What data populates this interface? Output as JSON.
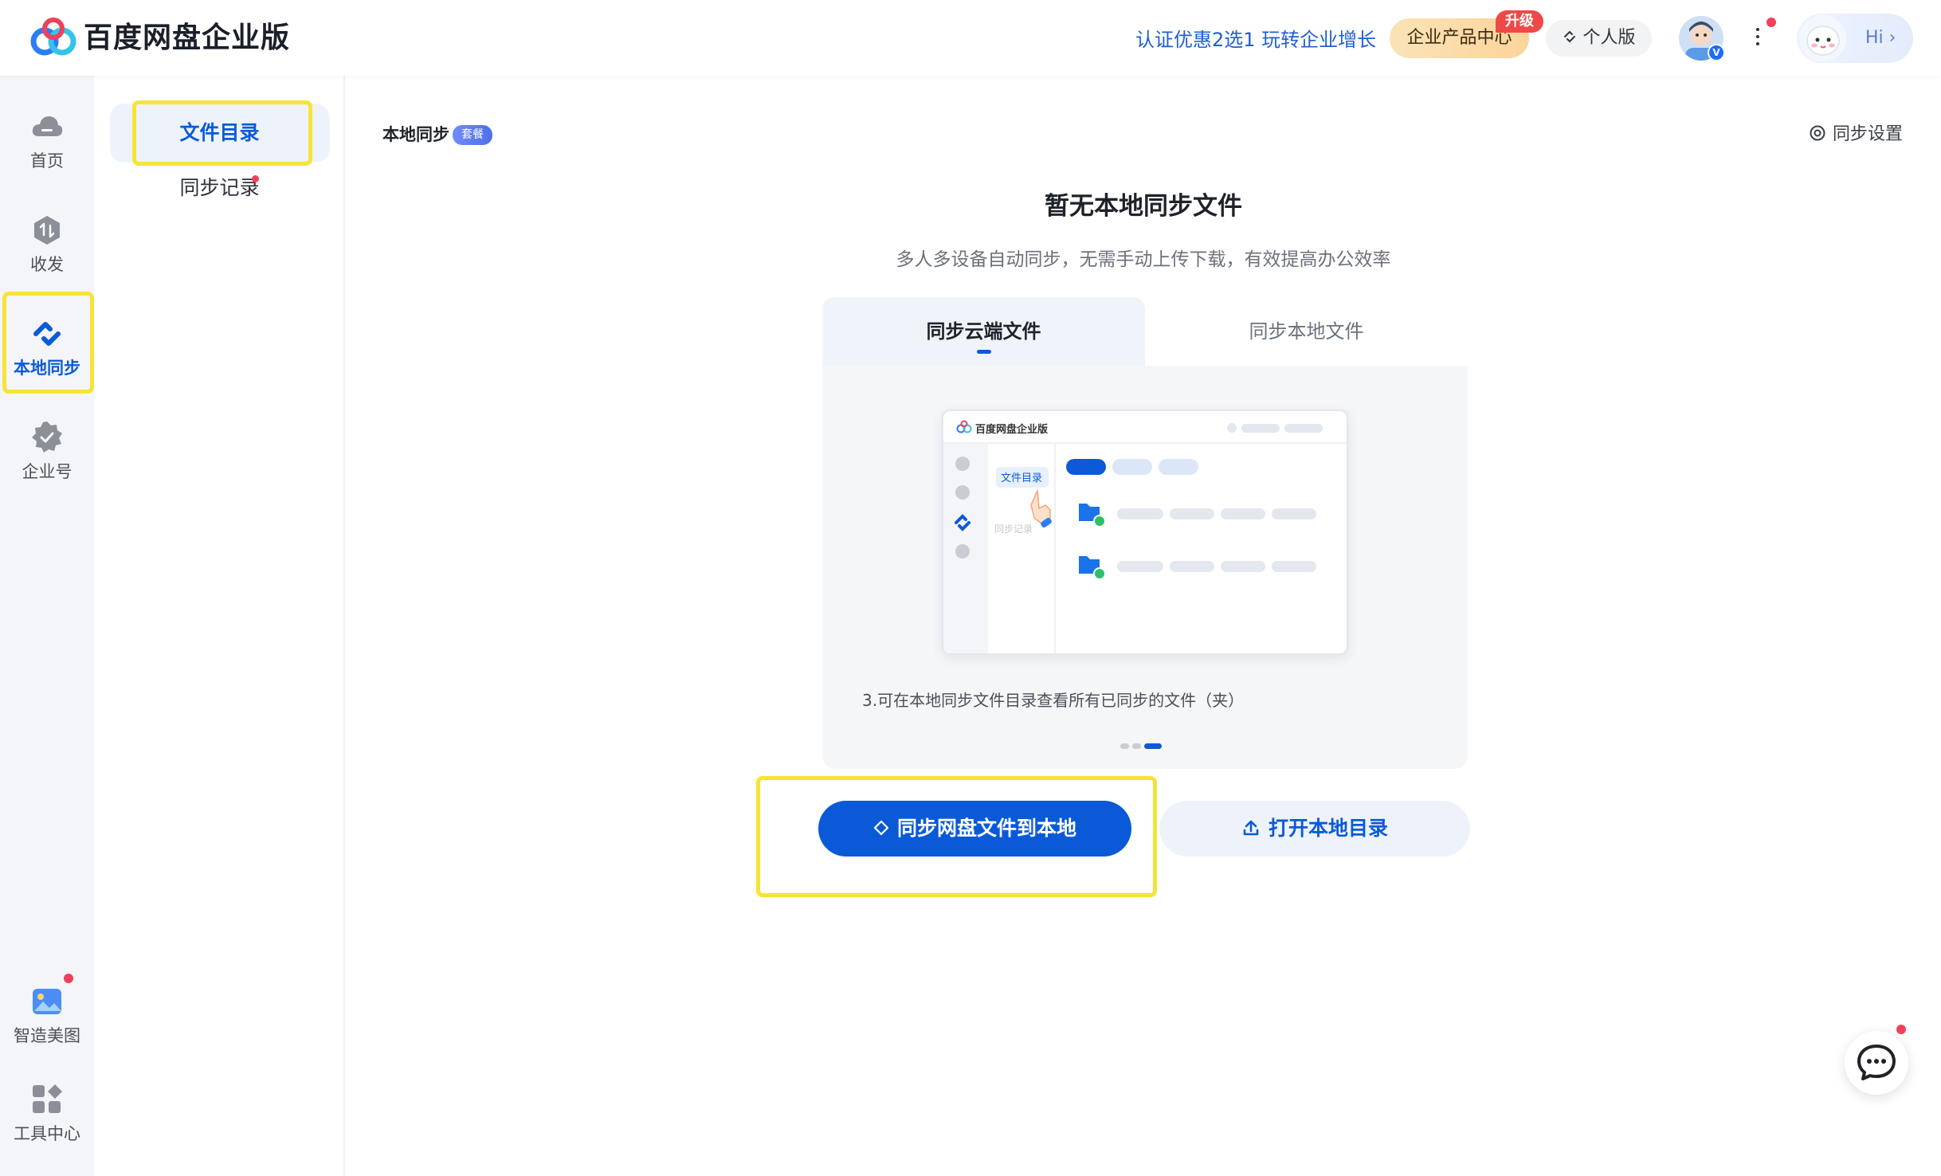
{
  "header": {
    "app_title": "百度网盘企业版",
    "promo_text": "认证优惠2选1 玩转企业增长",
    "product_center_label": "企业产品中心",
    "upgrade_badge": "升级",
    "personal_label": "个人版",
    "hi_label": "Hi",
    "hi_chevron": "›",
    "avatar_badge": "V",
    "icons": [
      "baidu-netdisk-logo",
      "personal-switch-icon",
      "avatar",
      "more-vertical-icon",
      "assistant-avatar"
    ]
  },
  "rail": {
    "items": [
      {
        "label": "首页",
        "icon": "cloud-icon",
        "active": false
      },
      {
        "label": "收发",
        "icon": "transfer-icon",
        "active": false
      },
      {
        "label": "本地同步",
        "icon": "sync-icon",
        "active": true
      },
      {
        "label": "企业号",
        "icon": "enterprise-badge-icon",
        "active": false
      },
      {
        "label": "智造美图",
        "icon": "image-icon",
        "active": false,
        "has_dot": true
      },
      {
        "label": "工具中心",
        "icon": "apps-icon",
        "active": false
      }
    ]
  },
  "subnav": {
    "items": [
      {
        "label": "文件目录",
        "selected": true
      },
      {
        "label": "同步记录",
        "selected": false,
        "has_dot": true
      }
    ]
  },
  "main": {
    "breadcrumb": "本地同步",
    "breadcrumb_tag": "套餐",
    "settings_label": "同步设置",
    "empty_title": "暂无本地同步文件",
    "empty_subtitle": "多人多设备自动同步，无需手动上传下载，有效提高办公效率",
    "tabs": [
      {
        "label": "同步云端文件",
        "active": true
      },
      {
        "label": "同步本地文件",
        "active": false
      }
    ],
    "carousel": {
      "caption": "3.可在本地同步文件目录查看所有已同步的文件（夹）",
      "total_slides": 3,
      "current_slide": 3,
      "mock": {
        "app_title": "百度网盘企业版",
        "menu_selected": "文件目录",
        "menu_other": "同步记录"
      }
    },
    "primary_button": "同步网盘文件到本地",
    "secondary_button": "打开本地目录"
  },
  "colors": {
    "accent": "#0A5AD7",
    "highlight": "#F7E337",
    "notify_dot": "#F2405B",
    "upgrade_badge": "#F04848"
  }
}
